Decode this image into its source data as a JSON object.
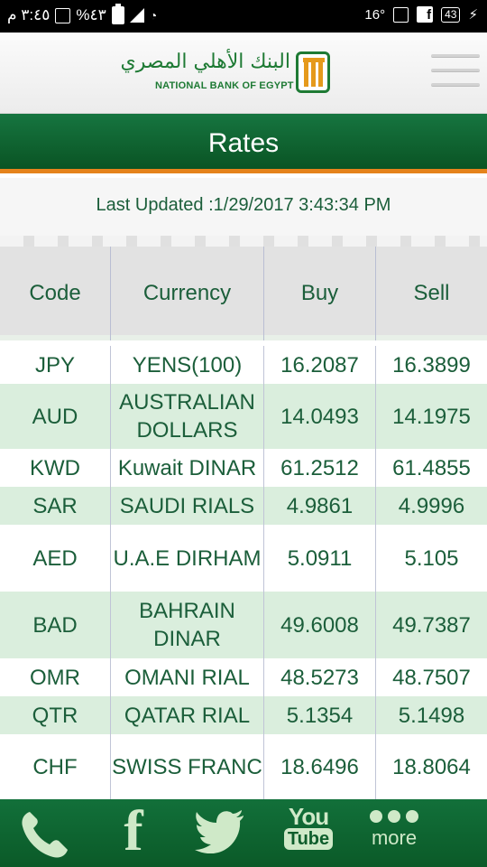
{
  "status_bar": {
    "time": "٣:٤٥ م",
    "battery": "%٤٣",
    "temp": "16°",
    "badge": "43"
  },
  "header": {
    "logo_arabic": "البنك الأهلي المصري",
    "logo_english": "NATIONAL BANK OF EGYPT"
  },
  "title": "Rates",
  "last_updated": "Last Updated :1/29/2017 3:43:34 PM",
  "table": {
    "headers": [
      "Code",
      "Currency",
      "Buy",
      "Sell"
    ],
    "rows": [
      {
        "code": "JPY",
        "currency": "YENS(100)",
        "buy": "16.2087",
        "sell": "16.3899"
      },
      {
        "code": "AUD",
        "currency": "AUSTRALIAN DOLLARS",
        "buy": "14.0493",
        "sell": "14.1975"
      },
      {
        "code": "KWD",
        "currency": "Kuwait DINAR",
        "buy": "61.2512",
        "sell": "61.4855"
      },
      {
        "code": "SAR",
        "currency": "SAUDI RIALS",
        "buy": "4.9861",
        "sell": "4.9996"
      },
      {
        "code": "AED",
        "currency": "U.A.E DIRHAM",
        "buy": "5.0911",
        "sell": "5.105"
      },
      {
        "code": "BAD",
        "currency": "BAHRAIN DINAR",
        "buy": "49.6008",
        "sell": "49.7387"
      },
      {
        "code": "OMR",
        "currency": "OMANI RIAL",
        "buy": "48.5273",
        "sell": "48.7507"
      },
      {
        "code": "QTR",
        "currency": "QATAR RIAL",
        "buy": "5.1354",
        "sell": "5.1498"
      },
      {
        "code": "CHF",
        "currency": "SWISS FRANC",
        "buy": "18.6496",
        "sell": "18.8064"
      }
    ]
  },
  "bottom_bar": {
    "youtube_top": "You",
    "youtube_bottom": "Tube",
    "more_label": "more"
  },
  "colors": {
    "brand_green": "#0b5a28",
    "accent_orange": "#e5831c",
    "text_green": "#1b5e3a",
    "row_alt": "#daeedd"
  }
}
